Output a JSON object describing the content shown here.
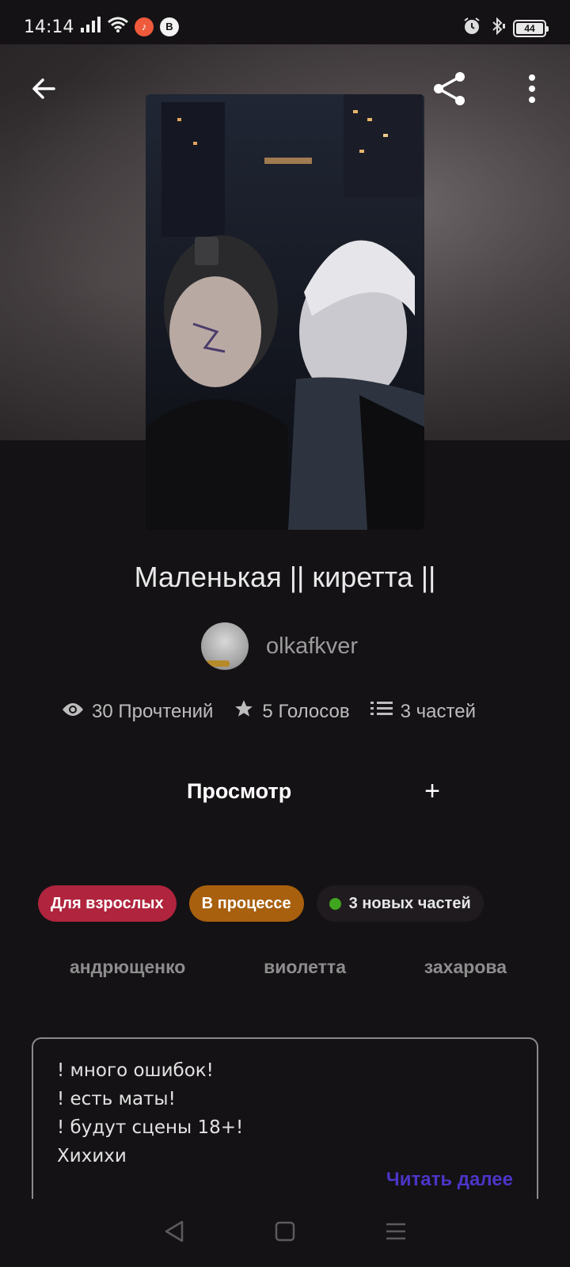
{
  "status_bar": {
    "time": "14:14",
    "battery": "44"
  },
  "story": {
    "title": "Маленькая  || киретта ||",
    "author": "olkafkver",
    "stats": {
      "reads": "30 Прочтений",
      "votes": "5 Голосов",
      "parts": "3 частей"
    }
  },
  "actions": {
    "view_label": "Просмотр",
    "add_label": "+"
  },
  "tags": {
    "mature": "Для взрослых",
    "status": "В процессе",
    "new_parts": "3 новых частей"
  },
  "keywords": [
    "андрющенко",
    "виолетта",
    "захарова"
  ],
  "description": {
    "lines": [
      "! много ошибок!",
      "! есть маты!",
      "! будут сцены 18+!",
      "Хихихи"
    ],
    "read_more": "Читать далее"
  },
  "colors": {
    "mature": "#b0243d",
    "in_progress": "#a8600e",
    "new_dot": "#3fa41e",
    "read_more": "#4b35c8"
  },
  "icons": {
    "back": "arrow-left-icon",
    "share": "share-icon",
    "more": "more-vertical-icon",
    "reads": "eye-icon",
    "votes": "star-icon",
    "parts": "list-icon",
    "nav_back": "triangle-back-icon",
    "nav_home": "square-home-icon",
    "nav_menu": "menu-lines-icon"
  }
}
